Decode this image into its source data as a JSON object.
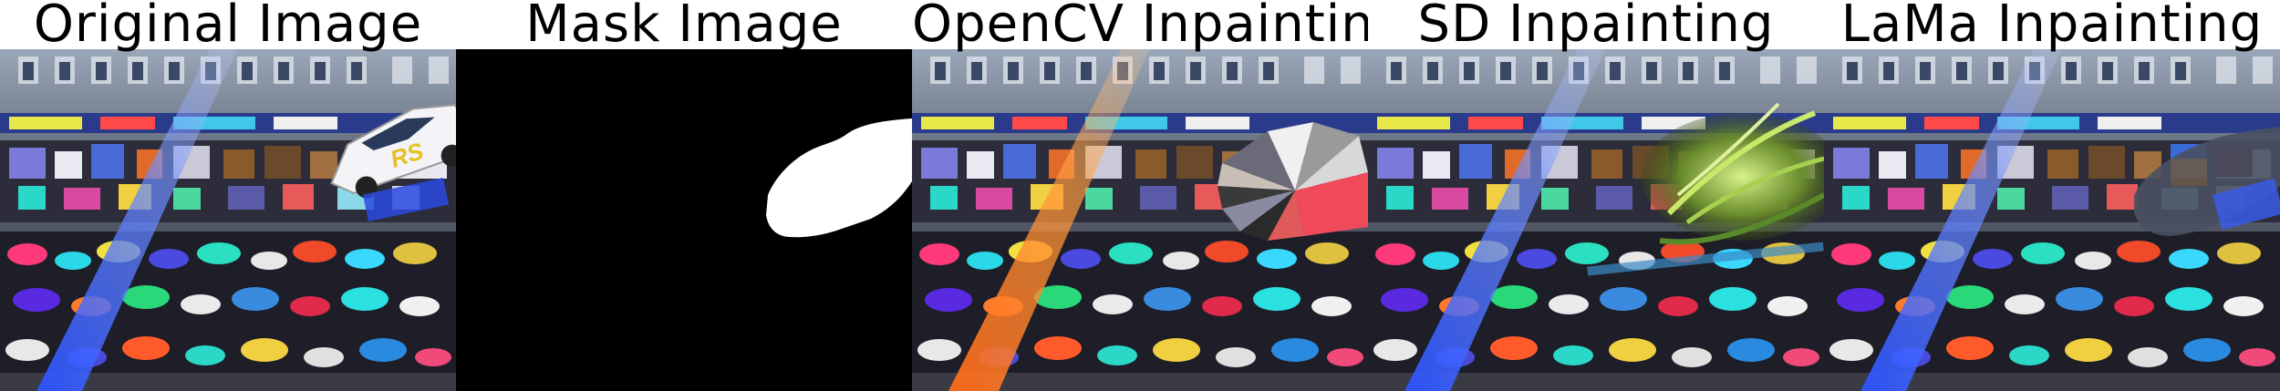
{
  "panels": [
    {
      "title": "Original Image"
    },
    {
      "title": "Mask Image"
    },
    {
      "title": "OpenCV Inpainting"
    },
    {
      "title": "SD Inpainting"
    },
    {
      "title": "LaMa Inpainting"
    }
  ]
}
